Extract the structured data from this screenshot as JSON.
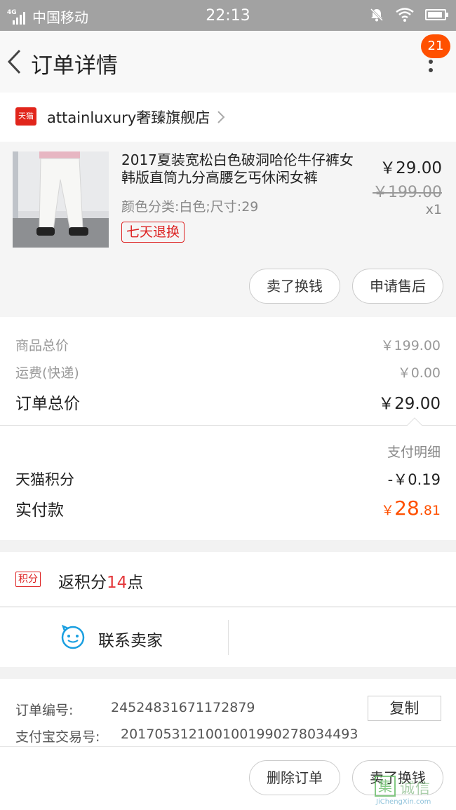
{
  "status_bar": {
    "network": "4G",
    "carrier": "中国移动",
    "time": "22:13"
  },
  "nav": {
    "title": "订单详情",
    "badge_count": "21"
  },
  "store": {
    "logo_text": "天猫",
    "name": "attainluxury奢臻旗舰店"
  },
  "product": {
    "title": "2017夏装宽松白色破洞哈伦牛仔裤女韩版直筒九分高腰乞丐休闲女裤",
    "sku": "颜色分类:白色;尺寸:29",
    "tag": "七天退换",
    "price": "￥29.00",
    "original_price": "￥199.00",
    "quantity": "x1",
    "buttons": [
      "卖了换钱",
      "申请售后"
    ]
  },
  "summary": {
    "rows": [
      {
        "label": "商品总价",
        "value": "￥199.00"
      },
      {
        "label": "运费(快递)",
        "value": "￥0.00"
      },
      {
        "label": "订单总价",
        "value": "￥29.00"
      }
    ],
    "payment_detail_label": "支付明细",
    "points_deduction_label": "天猫积分",
    "points_deduction_value": "-￥0.19",
    "paid_label": "实付款",
    "paid_currency": "￥",
    "paid_integer": "28",
    "paid_decimal": ".81"
  },
  "points": {
    "tag": "积分",
    "text_prefix": "返积分",
    "amount": "14",
    "text_suffix": "点"
  },
  "contact": {
    "label": "联系卖家"
  },
  "order_info": {
    "order_number_label": "订单编号:",
    "order_number": "24524831671172879",
    "alipay_label": "支付宝交易号:",
    "alipay_number": "2017053121001001990278034493",
    "copy_label": "复制"
  },
  "bottom_bar": {
    "buttons": [
      "删除订单",
      "卖了换钱"
    ]
  },
  "watermark": {
    "icon_char": "集",
    "text": "诚信",
    "domain": "JiChengXin.com"
  },
  "colors": {
    "accent": "#ff5000",
    "tmall_red": "#e1251b",
    "status_bar": "#a2a2a2"
  }
}
